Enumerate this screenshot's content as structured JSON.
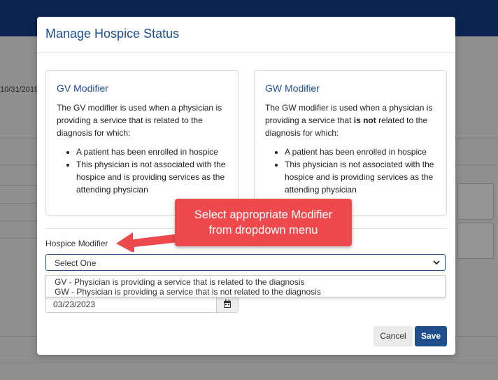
{
  "background": {
    "date_value": "10/31/2019"
  },
  "modal": {
    "title": "Manage Hospice Status",
    "gv_card": {
      "title": "GV Modifier",
      "intro": "The GV modifier is used when a physician is providing a service that is related to the diagnosis for which:",
      "bullets": [
        "A patient has been enrolled in hospice",
        "This physician is not associated with the hospice and is providing services as the attending physician"
      ]
    },
    "gw_card": {
      "title": "GW Modifier",
      "intro_before": "The GW modifier is used when a physician is providing a service that",
      "intro_bold": "is not",
      "intro_after": "related to the diagnosis for which:",
      "bullets": [
        "A patient has been enrolled in hospice",
        "This physician is not associated with the hospice and is providing services as the attending physician"
      ]
    },
    "hospice_modifier": {
      "label": "Hospice Modifier",
      "selected": "Select One",
      "options": [
        "GV - Physician is providing a service that is related to the diagnosis",
        "GW - Physician is providing a service that is not related to the diagnosis"
      ]
    },
    "date_field": {
      "value": "03/23/2023"
    },
    "buttons": {
      "cancel": "Cancel",
      "save": "Save"
    }
  },
  "annotation": {
    "line1": "Select appropriate Modifier",
    "line2": "from dropdown menu",
    "color": "#ee4a4d"
  },
  "colors": {
    "brand": "#1f4e8c",
    "topbar": "#0b2550"
  }
}
